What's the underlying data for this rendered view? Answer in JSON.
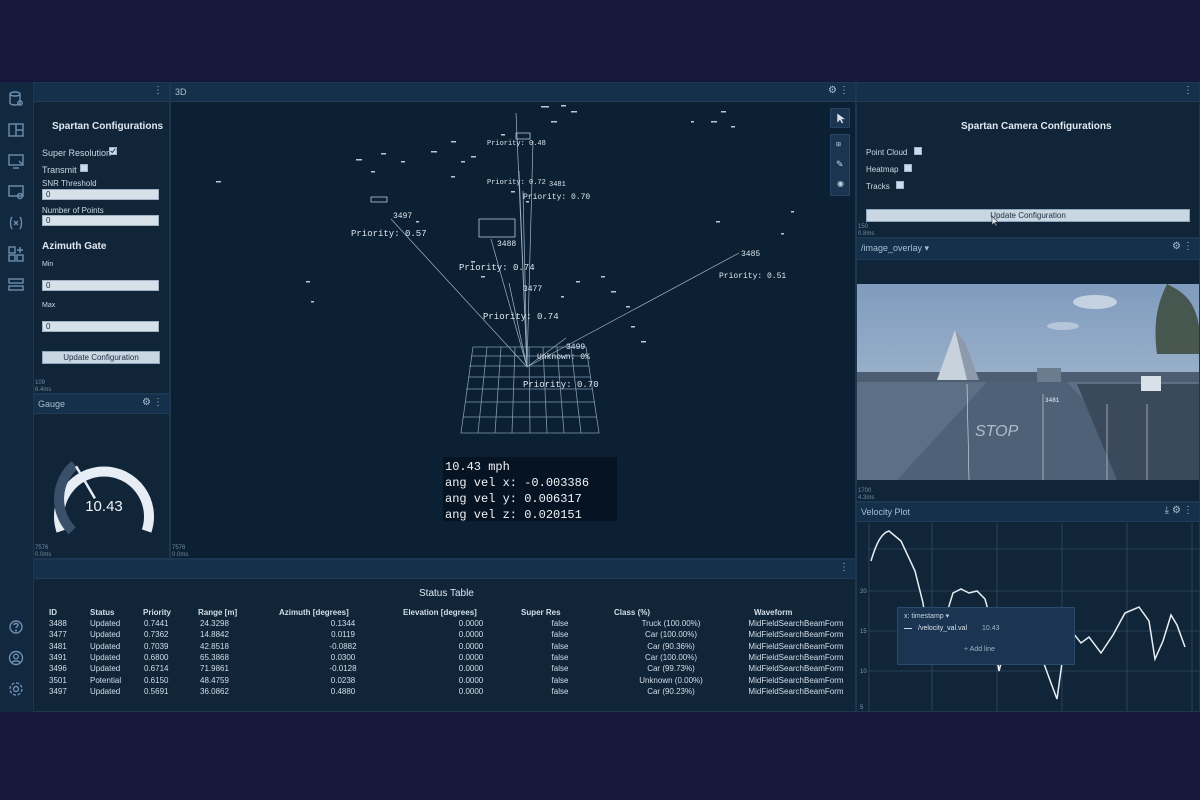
{
  "panels": {
    "left_config": {
      "title": "Spartan Configurations",
      "super_resolution_label": "Super Resolution",
      "super_resolution_checked": true,
      "transmit_label": "Transmit",
      "snr_label": "SNR Threshold",
      "snr_value": "0",
      "num_points_label": "Number of Points",
      "num_points_value": "0",
      "azimuth_title": "Azimuth Gate",
      "min_label": "Min",
      "min_value": "0",
      "max_label": "Max",
      "max_value": "0",
      "update_button": "Update Configuration",
      "footer_line1": "109",
      "footer_line2": "6.4ms"
    },
    "gauge": {
      "title": "Gauge",
      "value": "10.43",
      "fill_fraction": 0.35,
      "footer_line1": "7576",
      "footer_line2": "0.0ms"
    },
    "three_d": {
      "title": "3D",
      "footer_line1": "7576",
      "footer_line2": "0.0ms",
      "overlay": [
        "10.43 mph",
        "ang vel x: -0.003386",
        "ang vel y: 0.006317",
        "ang vel z: 0.020151"
      ],
      "labels": [
        {
          "id": "priority_057",
          "text": "Priority: 0.57"
        },
        {
          "id": "priority_074a",
          "text": "Priority: 0.74"
        },
        {
          "id": "priority_074b",
          "text": "Priority: 0.74"
        },
        {
          "id": "priority_070a",
          "text": "Priority: 0.70"
        },
        {
          "id": "priority_070b",
          "text": "Priority: 0.70"
        },
        {
          "id": "priority_051",
          "text": "Priority: 0.51"
        },
        {
          "id": "priority_048",
          "text": "Priority: 0.48"
        },
        {
          "id": "priority_072",
          "text": "Priority: 0.72"
        },
        {
          "id": "id_3497",
          "text": "3497"
        },
        {
          "id": "id_3488",
          "text": "3488"
        },
        {
          "id": "id_3477",
          "text": "3477"
        },
        {
          "id": "id_3499",
          "text": "3499"
        },
        {
          "id": "id_3485",
          "text": "3485"
        },
        {
          "id": "id_3481",
          "text": "3481"
        },
        {
          "id": "unknown",
          "text": "Unknown: 0%"
        }
      ]
    },
    "camera_config": {
      "title": "Spartan Camera Configurations",
      "point_cloud_label": "Point Cloud",
      "heatmap_label": "Heatmap",
      "tracks_label": "Tracks",
      "update_button": "Update Configuration",
      "footer_line1": "150",
      "footer_line2": "0.8ms"
    },
    "image": {
      "topic": "/image_overlay",
      "footer_line1": "1700",
      "footer_line2": "4.3ms",
      "stop_text": "STOP",
      "label_3481": "3481"
    },
    "velocity_plot": {
      "title": "Velocity Plot",
      "x_selector": "x: timestamp",
      "series_label": "/velocity_val.val",
      "series_value": "10.43",
      "add_line": "Add line",
      "y_ticks": [
        "20",
        "15",
        "10",
        "5"
      ]
    },
    "status_table": {
      "title": "Status Table",
      "columns": [
        "ID",
        "Status",
        "Priority",
        "Range [m]",
        "Azimuth [degrees]",
        "Elevation [degrees]",
        "Super Res",
        "Class (%)",
        "Waveform"
      ],
      "rows": [
        [
          "3488",
          "Updated",
          "0.7441",
          "24.3298",
          "0.1344",
          "0.0000",
          "false",
          "Truck (100.00%)",
          "MidFieldSearchBeamForm"
        ],
        [
          "3477",
          "Updated",
          "0.7362",
          "14.8842",
          "0.0119",
          "0.0000",
          "false",
          "Car (100.00%)",
          "MidFieldSearchBeamForm"
        ],
        [
          "3481",
          "Updated",
          "0.7039",
          "42.8518",
          "-0.0882",
          "0.0000",
          "false",
          "Car (90.36%)",
          "MidFieldSearchBeamForm"
        ],
        [
          "3491",
          "Updated",
          "0.6800",
          "65.3868",
          "0.0300",
          "0.0000",
          "false",
          "Car (100.00%)",
          "MidFieldSearchBeamForm"
        ],
        [
          "3496",
          "Updated",
          "0.6714",
          "71.9861",
          "-0.0128",
          "0.0000",
          "false",
          "Car (99.73%)",
          "MidFieldSearchBeamForm"
        ],
        [
          "3501",
          "Potential",
          "0.6150",
          "48.4759",
          "0.0238",
          "0.0000",
          "false",
          "Unknown (0.00%)",
          "MidFieldSearchBeamForm"
        ],
        [
          "3497",
          "Updated",
          "0.5691",
          "36.0862",
          "0.4880",
          "0.0000",
          "false",
          "Car (90.23%)",
          "MidFieldSearchBeamForm"
        ]
      ]
    }
  },
  "icons": [
    "database-icon",
    "layout-icon",
    "monitor-icon",
    "monitor-settings-icon",
    "variable-icon",
    "add-panel-icon",
    "list-icon",
    "help-icon",
    "user-icon",
    "settings-icon"
  ],
  "colors": {
    "accent": "#c9d7e3",
    "panel": "#102538",
    "background": "#16173a"
  }
}
